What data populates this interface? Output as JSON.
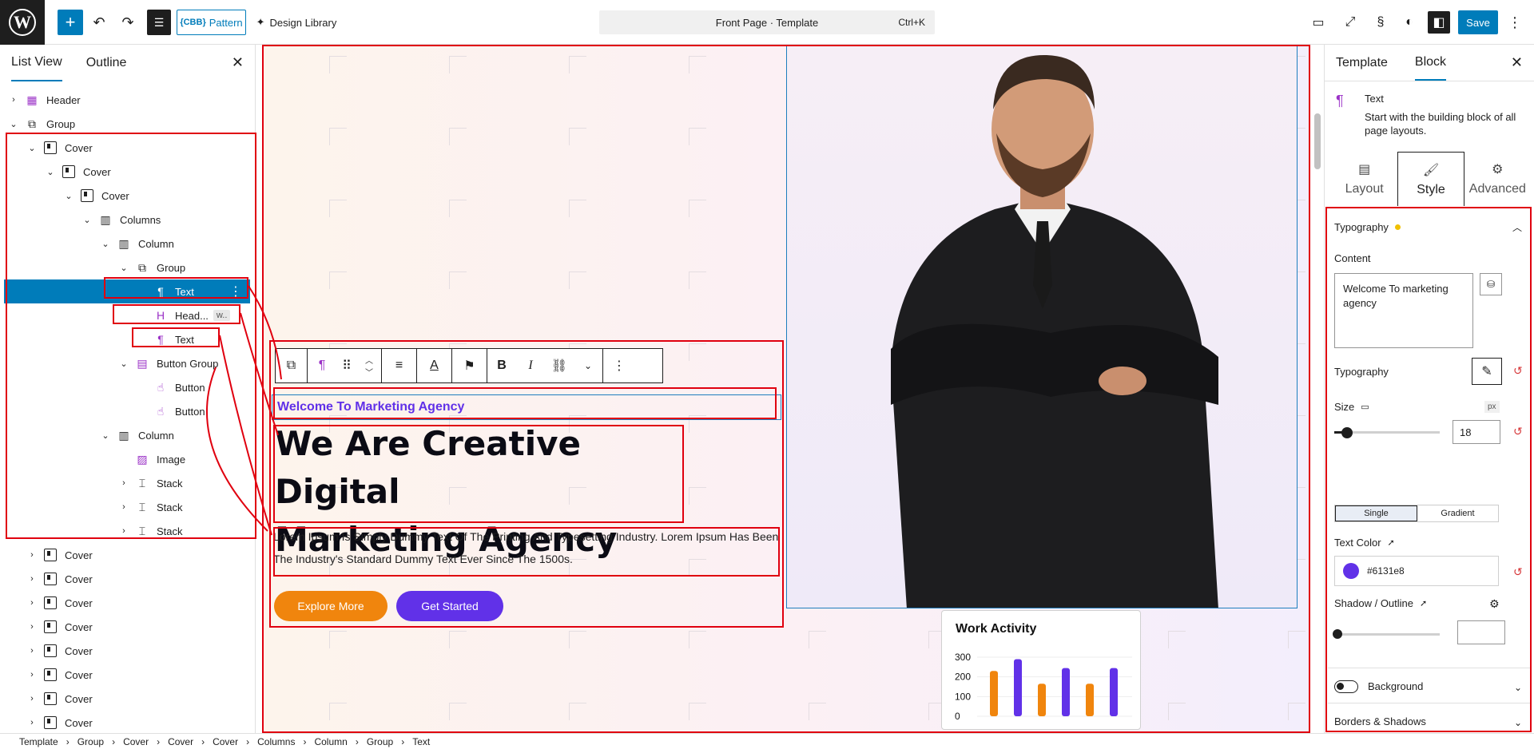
{
  "topbar": {
    "pattern_label": "Pattern",
    "pattern_badge": "{CBB}",
    "design_library": "Design Library",
    "command_title": "Front Page · Template",
    "command_shortcut": "Ctrl+K",
    "save_label": "Save"
  },
  "left_panel": {
    "tabs": [
      "List View",
      "Outline"
    ],
    "rows": [
      {
        "label": "Header",
        "indent": 0,
        "chev": "›",
        "icon": "header"
      },
      {
        "label": "Group",
        "indent": 0,
        "chev": "⌄",
        "icon": "group"
      },
      {
        "label": "Cover",
        "indent": 1,
        "chev": "⌄",
        "icon": "cover"
      },
      {
        "label": "Cover",
        "indent": 2,
        "chev": "⌄",
        "icon": "cover"
      },
      {
        "label": "Cover",
        "indent": 3,
        "chev": "⌄",
        "icon": "cover"
      },
      {
        "label": "Columns",
        "indent": 4,
        "chev": "⌄",
        "icon": "columns"
      },
      {
        "label": "Column",
        "indent": 5,
        "chev": "⌄",
        "icon": "column"
      },
      {
        "label": "Group",
        "indent": 6,
        "chev": "⌄",
        "icon": "group"
      },
      {
        "label": "Text",
        "indent": 7,
        "chev": "",
        "icon": "paragraph",
        "selected": true
      },
      {
        "label": "Head...",
        "indent": 7,
        "chev": "",
        "icon": "heading",
        "badge": "w.."
      },
      {
        "label": "Text",
        "indent": 7,
        "chev": "",
        "icon": "paragraph"
      },
      {
        "label": "Button Group",
        "indent": 6,
        "chev": "⌄",
        "icon": "buttons"
      },
      {
        "label": "Button",
        "indent": 7,
        "chev": "",
        "icon": "button"
      },
      {
        "label": "Button",
        "indent": 7,
        "chev": "",
        "icon": "button"
      },
      {
        "label": "Column",
        "indent": 5,
        "chev": "⌄",
        "icon": "column"
      },
      {
        "label": "Image",
        "indent": 6,
        "chev": "",
        "icon": "image"
      },
      {
        "label": "Stack",
        "indent": 6,
        "chev": "›",
        "icon": "stack"
      },
      {
        "label": "Stack",
        "indent": 6,
        "chev": "›",
        "icon": "stack"
      },
      {
        "label": "Stack",
        "indent": 6,
        "chev": "›",
        "icon": "stack"
      },
      {
        "label": "Cover",
        "indent": 1,
        "chev": "›",
        "icon": "cover"
      },
      {
        "label": "Cover",
        "indent": 1,
        "chev": "›",
        "icon": "cover"
      },
      {
        "label": "Cover",
        "indent": 1,
        "chev": "›",
        "icon": "cover"
      },
      {
        "label": "Cover",
        "indent": 1,
        "chev": "›",
        "icon": "cover"
      },
      {
        "label": "Cover",
        "indent": 1,
        "chev": "›",
        "icon": "cover"
      },
      {
        "label": "Cover",
        "indent": 1,
        "chev": "›",
        "icon": "cover"
      },
      {
        "label": "Cover",
        "indent": 1,
        "chev": "›",
        "icon": "cover"
      },
      {
        "label": "Cover",
        "indent": 1,
        "chev": "›",
        "icon": "cover"
      }
    ]
  },
  "canvas": {
    "eyebrow": "Welcome To Marketing Agency",
    "headline_line1": "We Are Creative Digital",
    "headline_line2": "Marketing Agency",
    "paragraph": "Lorem Ipsum Is Simply Dummy Text Of The Printing And Typesetting Industry. Lorem Ipsum Has Been The Industry's Standard Dummy Text Ever Since The 1500s.",
    "cta_primary": "Explore More",
    "cta_secondary": "Get Started",
    "work_card": {
      "title": "Work Activity",
      "y_ticks": [
        "300",
        "200",
        "100",
        "0"
      ],
      "bars": [
        {
          "value": 230,
          "color": "#f0850d"
        },
        {
          "value": 290,
          "color": "#6131e8"
        },
        {
          "value": 165,
          "color": "#f0850d"
        },
        {
          "value": 245,
          "color": "#6131e8"
        },
        {
          "value": 165,
          "color": "#f0850d"
        },
        {
          "value": 245,
          "color": "#6131e8"
        }
      ],
      "ymax": 300
    }
  },
  "right_panel": {
    "tabs": [
      "Template",
      "Block"
    ],
    "block_title": "Text",
    "block_desc": "Start with the building block of all page layouts.",
    "sub_tabs": [
      "Layout",
      "Style",
      "Advanced"
    ],
    "typography_heading": "Typography",
    "content_label": "Content",
    "content_value": "Welcome To marketing agency",
    "typography_label": "Typography",
    "size_label": "Size",
    "size_unit": "px",
    "size_value": "18",
    "size_fraction": 0.12,
    "seg_single": "Single",
    "seg_gradient": "Gradient",
    "text_color_label": "Text Color",
    "text_color_value": "#6131e8",
    "shadow_label": "Shadow / Outline",
    "background_label": "Background",
    "borders_label": "Borders & Shadows"
  },
  "breadcrumb": [
    "Template",
    "Group",
    "Cover",
    "Cover",
    "Cover",
    "Columns",
    "Column",
    "Group",
    "Text"
  ],
  "colors": {
    "accent": "#007cba",
    "brand_purple": "#6131e8",
    "brand_orange": "#f0850d",
    "annotation_red": "#e0000f"
  }
}
